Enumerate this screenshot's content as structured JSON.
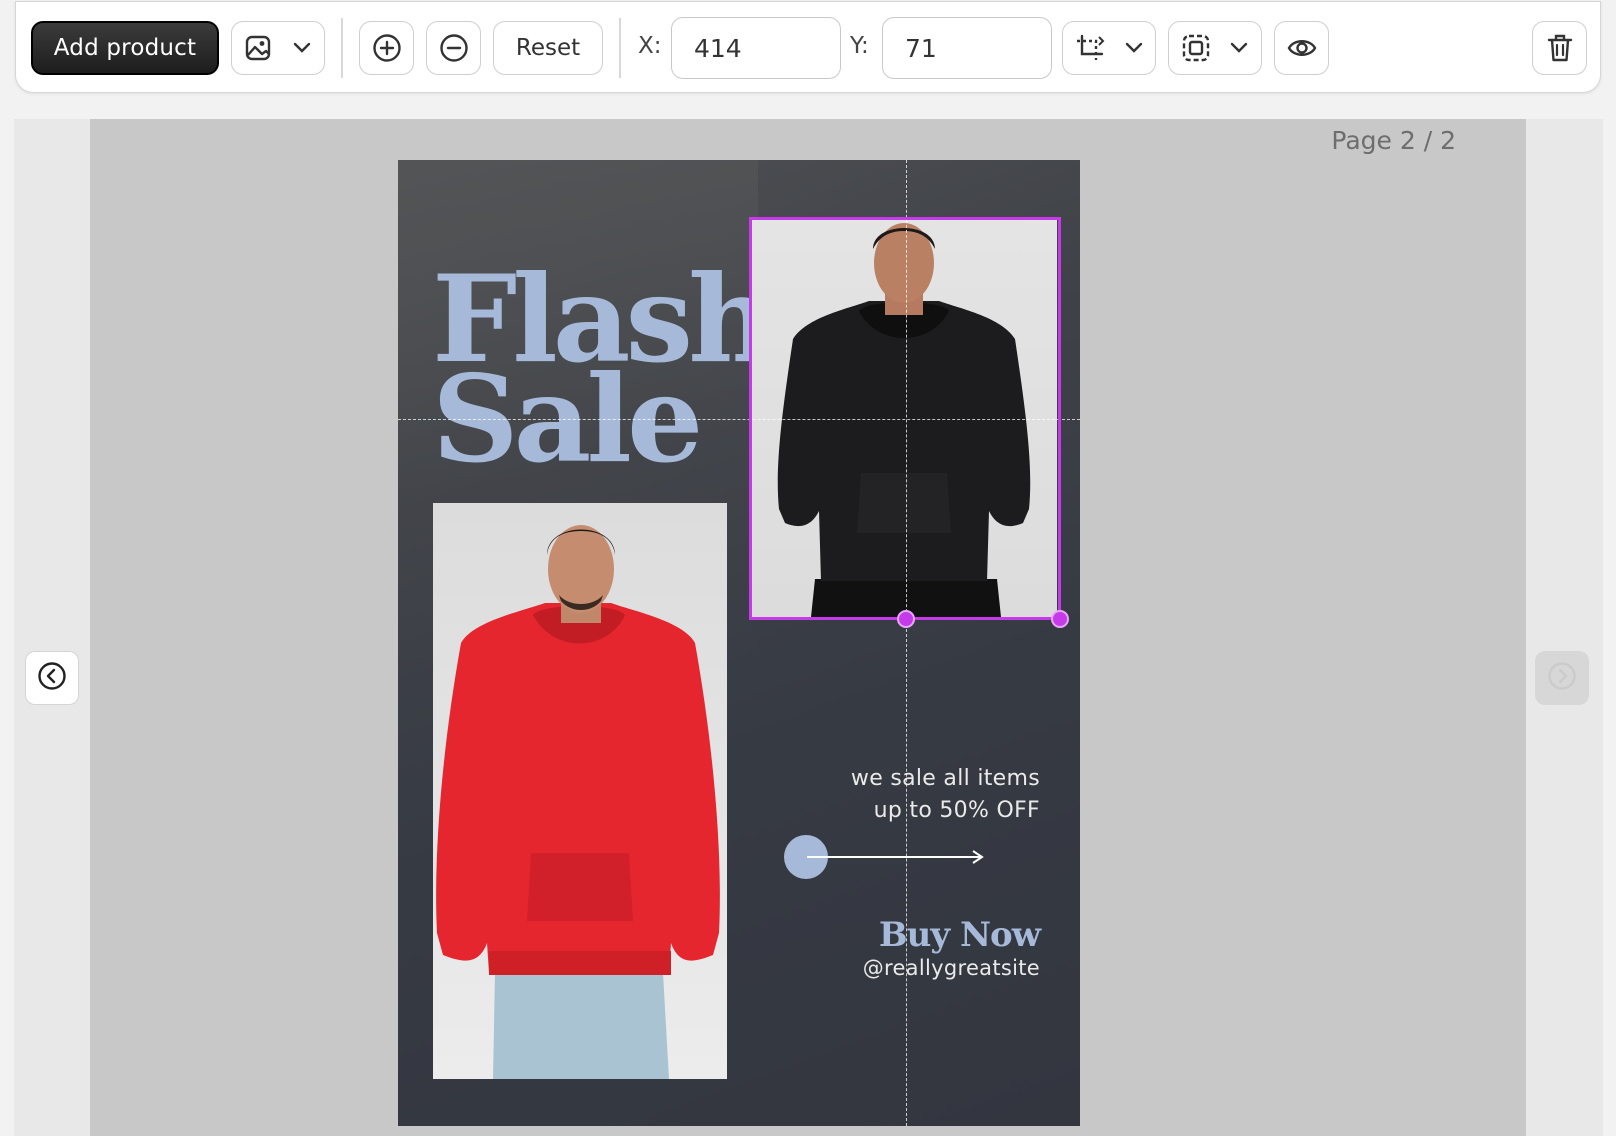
{
  "toolbar": {
    "add_product_label": "Add product",
    "image_menu_icon": "image-icon",
    "zoom_in_icon": "plus-circle-icon",
    "zoom_out_icon": "minus-circle-icon",
    "reset_label": "Reset",
    "x_label": "X:",
    "x_value": "414",
    "y_label": "Y:",
    "y_value": "71",
    "crop_icon": "crop-icon",
    "frame_icon": "frame-icon",
    "preview_icon": "eye-icon",
    "delete_icon": "trash-icon"
  },
  "canvas": {
    "page_indicator": "Page 2 / 2",
    "prev_icon": "chevron-left-circle-icon",
    "next_icon": "chevron-right-circle-icon"
  },
  "poster": {
    "title_line1": "Flash",
    "title_line2": "Sale",
    "tagline_line1": "we sale all items",
    "tagline_line2": "up to 50% OFF",
    "cta": "Buy Now",
    "handle": "@reallygreatsite"
  },
  "colors": {
    "accent_text": "#a7b9d9",
    "poster_bg": "#363a43",
    "selection": "#c53bea",
    "hoodie_red": "#e5262f",
    "hoodie_black": "#1c1c1e"
  }
}
